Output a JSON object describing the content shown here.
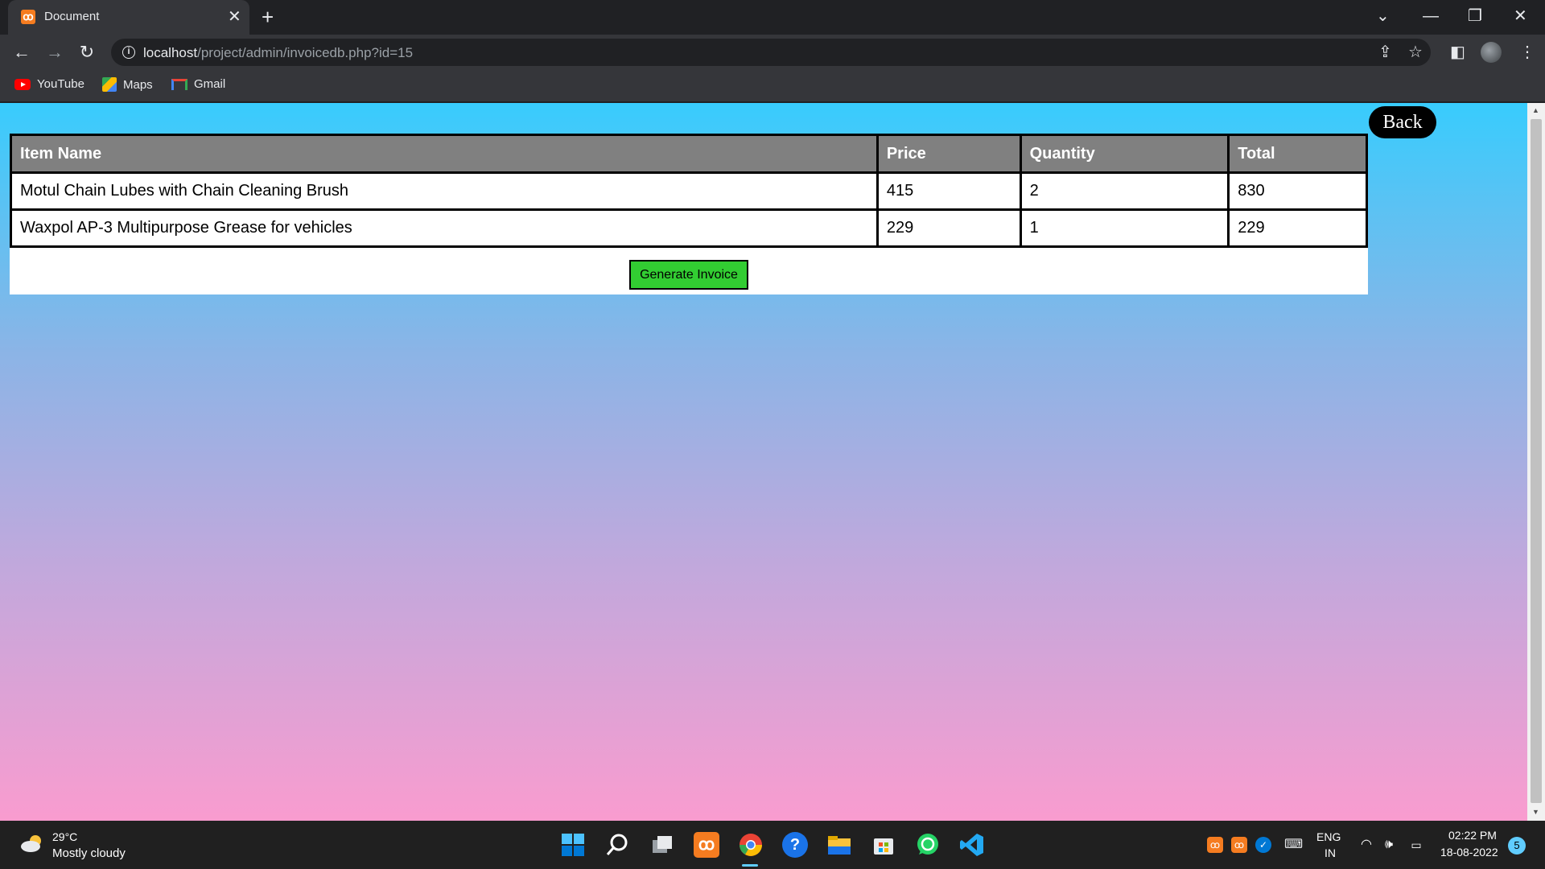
{
  "browser": {
    "tab_title": "Document",
    "url_host": "localhost",
    "url_path": "/project/admin/invoicedb.php?id=15",
    "bookmarks": [
      "YouTube",
      "Maps",
      "Gmail"
    ]
  },
  "page": {
    "back_label": "Back",
    "table": {
      "headers": [
        "Item Name",
        "Price",
        "Quantity",
        "Total"
      ],
      "rows": [
        [
          "Motul Chain Lubes with Chain Cleaning Brush",
          "415",
          "2",
          "830"
        ],
        [
          "Waxpol AP-3 Multipurpose Grease for vehicles",
          "229",
          "1",
          "229"
        ]
      ]
    },
    "generate_label": "Generate Invoice"
  },
  "taskbar": {
    "weather_temp": "29°C",
    "weather_desc": "Mostly cloudy",
    "lang_top": "ENG",
    "lang_bottom": "IN",
    "time": "02:22 PM",
    "date": "18-08-2022",
    "notification_count": "5"
  },
  "colors": {
    "header_bg": "#808080",
    "generate_bg": "#32cd32",
    "gradient_top": "#38ccfd",
    "gradient_bottom": "#f99ccf"
  }
}
